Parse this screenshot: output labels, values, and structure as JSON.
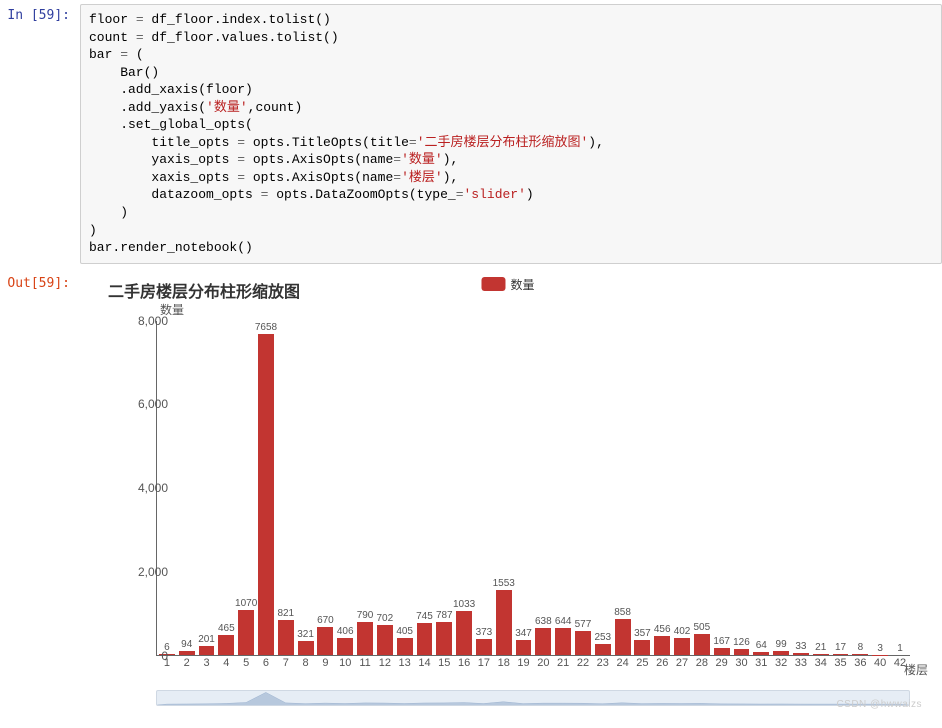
{
  "cell_in_prompt": "In [59]:",
  "cell_out_prompt": "Out[59]:",
  "code_lines": [
    {
      "t": [
        {
          "c": "nm",
          "v": "floor "
        },
        {
          "c": "op",
          "v": "="
        },
        {
          "c": "nm",
          "v": " df_floor.index.tolist()"
        }
      ]
    },
    {
      "t": [
        {
          "c": "nm",
          "v": "count "
        },
        {
          "c": "op",
          "v": "="
        },
        {
          "c": "nm",
          "v": " df_floor.values.tolist()"
        }
      ]
    },
    {
      "t": [
        {
          "c": "nm",
          "v": "bar "
        },
        {
          "c": "op",
          "v": "="
        },
        {
          "c": "nm",
          "v": " ("
        }
      ]
    },
    {
      "t": [
        {
          "c": "nm",
          "v": "    Bar()"
        }
      ]
    },
    {
      "t": [
        {
          "c": "nm",
          "v": "    .add_xaxis(floor)"
        }
      ]
    },
    {
      "t": [
        {
          "c": "nm",
          "v": "    .add_yaxis("
        },
        {
          "c": "str",
          "v": "'数量'"
        },
        {
          "c": "nm",
          "v": ",count)"
        }
      ]
    },
    {
      "t": [
        {
          "c": "nm",
          "v": "    .set_global_opts("
        }
      ]
    },
    {
      "t": [
        {
          "c": "nm",
          "v": "        title_opts "
        },
        {
          "c": "op",
          "v": "="
        },
        {
          "c": "nm",
          "v": " opts.TitleOpts(title"
        },
        {
          "c": "op",
          "v": "="
        },
        {
          "c": "str",
          "v": "'二手房楼层分布柱形缩放图'"
        },
        {
          "c": "nm",
          "v": "),"
        }
      ]
    },
    {
      "t": [
        {
          "c": "nm",
          "v": "        yaxis_opts "
        },
        {
          "c": "op",
          "v": "="
        },
        {
          "c": "nm",
          "v": " opts.AxisOpts(name"
        },
        {
          "c": "op",
          "v": "="
        },
        {
          "c": "str",
          "v": "'数量'"
        },
        {
          "c": "nm",
          "v": "),"
        }
      ]
    },
    {
      "t": [
        {
          "c": "nm",
          "v": "        xaxis_opts "
        },
        {
          "c": "op",
          "v": "="
        },
        {
          "c": "nm",
          "v": " opts.AxisOpts(name"
        },
        {
          "c": "op",
          "v": "="
        },
        {
          "c": "str",
          "v": "'楼层'"
        },
        {
          "c": "nm",
          "v": "),"
        }
      ]
    },
    {
      "t": [
        {
          "c": "nm",
          "v": "        datazoom_opts "
        },
        {
          "c": "op",
          "v": "="
        },
        {
          "c": "nm",
          "v": " opts.DataZoomOpts(type_"
        },
        {
          "c": "op",
          "v": "="
        },
        {
          "c": "str",
          "v": "'slider'"
        },
        {
          "c": "nm",
          "v": ")"
        }
      ]
    },
    {
      "t": [
        {
          "c": "nm",
          "v": "    )"
        }
      ]
    },
    {
      "t": [
        {
          "c": "nm",
          "v": ")"
        }
      ]
    },
    {
      "t": [
        {
          "c": "nm",
          "v": "bar.render_notebook()"
        }
      ]
    }
  ],
  "chart_data": {
    "type": "bar",
    "title": "二手房楼层分布柱形缩放图",
    "legend": "数量",
    "xlabel": "楼层",
    "ylabel": "数量",
    "ylim": [
      0,
      8000
    ],
    "y_ticks": [
      0,
      2000,
      4000,
      6000,
      8000
    ],
    "y_tick_labels": [
      "0",
      "2,000",
      "4,000",
      "6,000",
      "8,000"
    ],
    "categories": [
      "1",
      "2",
      "3",
      "4",
      "5",
      "6",
      "7",
      "8",
      "9",
      "10",
      "11",
      "12",
      "13",
      "14",
      "15",
      "16",
      "17",
      "18",
      "19",
      "20",
      "21",
      "22",
      "23",
      "24",
      "25",
      "26",
      "27",
      "28",
      "29",
      "30",
      "31",
      "32",
      "33",
      "34",
      "35",
      "36",
      "40",
      "42"
    ],
    "values": [
      6,
      94,
      201,
      465,
      1070,
      7658,
      821,
      321,
      670,
      406,
      790,
      702,
      405,
      745,
      787,
      1033,
      373,
      1553,
      347,
      638,
      644,
      577,
      253,
      858,
      357,
      456,
      402,
      505,
      167,
      126,
      64,
      99,
      33,
      21,
      17,
      8,
      3,
      1
    ],
    "series": [
      {
        "name": "数量",
        "values": [
          6,
          94,
          201,
          465,
          1070,
          7658,
          821,
          321,
          670,
          406,
          790,
          702,
          405,
          745,
          787,
          1033,
          373,
          1553,
          347,
          638,
          644,
          577,
          253,
          858,
          357,
          456,
          402,
          505,
          167,
          126,
          64,
          99,
          33,
          21,
          17,
          8,
          3,
          1
        ]
      }
    ],
    "color": "#c23531"
  },
  "watermark": "CSDN @hwwaizs"
}
